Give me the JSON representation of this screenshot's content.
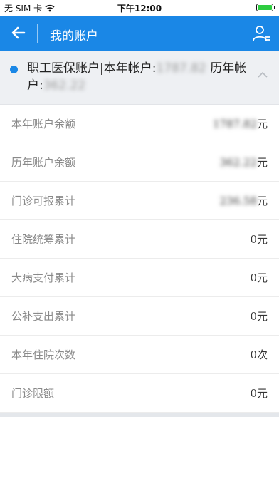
{
  "status_bar": {
    "carrier": "无 SIM 卡",
    "time": "下午12:00"
  },
  "nav": {
    "title": "我的账户",
    "back_icon": "arrow-left-icon",
    "user_icon": "user-list-icon"
  },
  "account": {
    "label_main": "职工医保账户|本年帐户:",
    "current_year_value": "1787.82",
    "label_history": "历年帐户:",
    "history_value": "362.22"
  },
  "rows": [
    {
      "label": "本年账户余额",
      "value": "1787.82",
      "unit": "元",
      "blurred": true
    },
    {
      "label": "历年账户余额",
      "value": "362.22",
      "unit": "元",
      "blurred": true
    },
    {
      "label": "门诊可报累计",
      "value": "236.58",
      "unit": "元",
      "blurred": true
    },
    {
      "label": "住院统筹累计",
      "value": "0",
      "unit": "元",
      "blurred": false
    },
    {
      "label": "大病支付累计",
      "value": "0",
      "unit": "元",
      "blurred": false
    },
    {
      "label": "公补支出累计",
      "value": "0",
      "unit": "元",
      "blurred": false
    },
    {
      "label": "本年住院次数",
      "value": "0",
      "unit": "次",
      "blurred": false
    },
    {
      "label": "门诊限额",
      "value": "0",
      "unit": "元",
      "blurred": false
    }
  ],
  "colors": {
    "brand": "#1a87e6",
    "header_bg": "#eef0f3"
  }
}
